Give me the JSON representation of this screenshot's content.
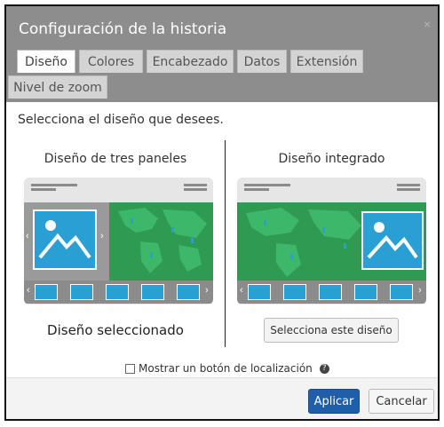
{
  "dialog": {
    "title": "Configuración de la historia",
    "close_glyph": "×"
  },
  "tabs": [
    {
      "label": "Diseño",
      "active": true
    },
    {
      "label": "Colores",
      "active": false
    },
    {
      "label": "Encabezado",
      "active": false
    },
    {
      "label": "Datos",
      "active": false
    },
    {
      "label": "Extensión",
      "active": false
    },
    {
      "label": "Nivel de zoom",
      "active": false
    }
  ],
  "content": {
    "prompt": "Selecciona el diseño que desees.",
    "layouts": [
      {
        "title": "Diseño de tres paneles",
        "status": "Diseño seleccionado"
      },
      {
        "title": "Diseño integrado",
        "button_label": "Selecciona este diseño"
      }
    ],
    "location_checkbox": {
      "label": "Mostrar un botón de localización",
      "checked": false
    }
  },
  "footer": {
    "apply_label": "Aplicar",
    "cancel_label": "Cancelar"
  },
  "colors": {
    "header_bg": "#8d8d8d",
    "primary_button": "#1f5ea8",
    "map_green": "#2e9a52",
    "media_blue": "#2a9fd4"
  }
}
